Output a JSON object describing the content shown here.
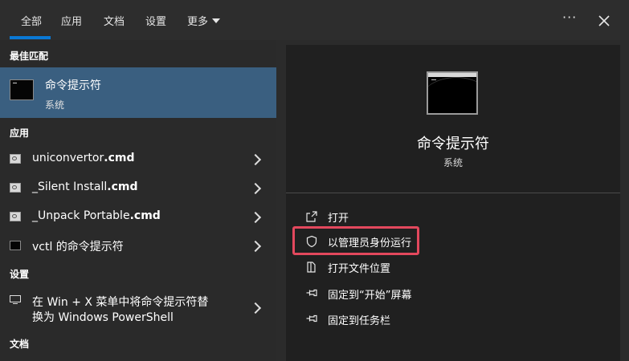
{
  "tabs": [
    {
      "label": "全部",
      "active": true
    },
    {
      "label": "应用"
    },
    {
      "label": "文档"
    },
    {
      "label": "设置"
    },
    {
      "label": "更多"
    }
  ],
  "window_controls": {
    "more_options": "···",
    "close": "close-icon"
  },
  "left": {
    "best_match_heading": "最佳匹配",
    "best_match": {
      "title": "命令提示符",
      "subtitle": "系统"
    },
    "apps_heading": "应用",
    "apps": [
      {
        "name": "uniconvertor",
        "ext": ".cmd"
      },
      {
        "name": "_Silent Install",
        "ext": ".cmd"
      },
      {
        "name": "_Unpack Portable",
        "ext": ".cmd"
      },
      {
        "name": "vctl 的命令提示符",
        "ext": ""
      }
    ],
    "settings_heading": "设置",
    "setting_item": {
      "line1": "在 Win + X 菜单中将命令提示符替",
      "line2": "换为 Windows PowerShell"
    },
    "docs_heading": "文档"
  },
  "right": {
    "title": "命令提示符",
    "subtitle": "系统",
    "actions": [
      {
        "label": "打开",
        "icon": "open-icon"
      },
      {
        "label": "以管理员身份运行",
        "icon": "shield-icon",
        "highlighted": true
      },
      {
        "label": "打开文件位置",
        "icon": "folder-icon"
      },
      {
        "label": "固定到“开始”屏幕",
        "icon": "pin-icon"
      },
      {
        "label": "固定到任务栏",
        "icon": "pin-icon"
      }
    ]
  },
  "colors": {
    "accent": "#0a78d4",
    "selected_row": "#3a5f80",
    "highlight_border": "#e3485d"
  }
}
